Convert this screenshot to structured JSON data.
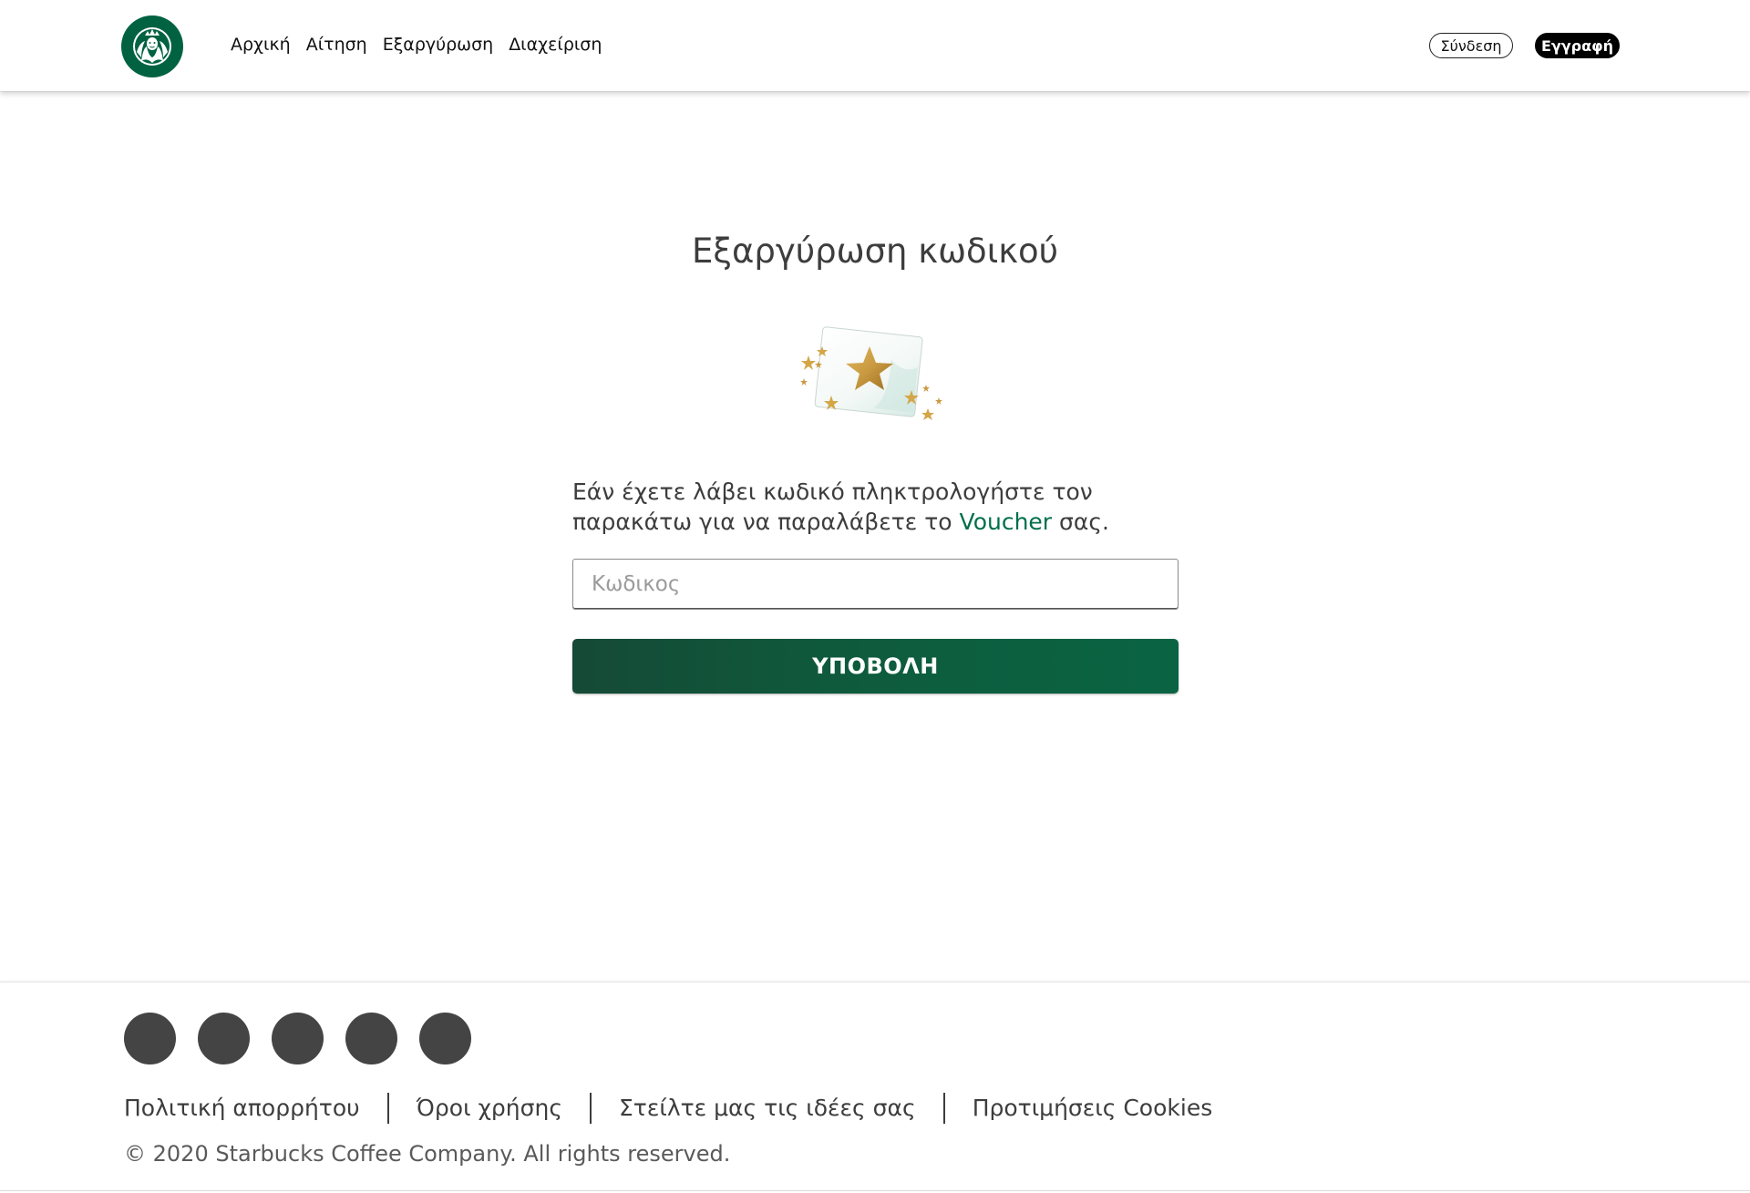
{
  "header": {
    "logo": "starbucks-siren-logo",
    "nav": [
      {
        "label": "Αρχική"
      },
      {
        "label": "Αίτηση"
      },
      {
        "label": "Εξαργύρωση"
      },
      {
        "label": "Διαχείριση"
      }
    ],
    "login_label": "Σύνδεση",
    "register_label": "Εγγραφή"
  },
  "main": {
    "title": "Εξαργύρωση κωδικού",
    "illustration": "voucher-card-stars",
    "instructions_before": "Εάν έχετε λάβει κωδικό πληκτρολογήστε τον παρακάτω για να παραλάβετε το ",
    "instructions_highlight": "Voucher",
    "instructions_after": " σας.",
    "code_input": {
      "value": "",
      "placeholder": "Κωδικος"
    },
    "submit_label": "ΥΠΟΒΟΛΗ"
  },
  "footer": {
    "social_icons": [
      "social-icon-1",
      "social-icon-2",
      "social-icon-3",
      "social-icon-4",
      "social-icon-5"
    ],
    "links": [
      {
        "label": "Πολιτική απορρήτου"
      },
      {
        "label": "Όροι χρήσης"
      },
      {
        "label": "Στείλτε μας τις ιδέες σας"
      },
      {
        "label": "Προτιμήσεις Cookies"
      }
    ],
    "copyright": "© 2020 Starbucks Coffee Company. All rights reserved."
  },
  "colors": {
    "brand_green": "#00704a",
    "button_green": "#0e5c3d",
    "text": "#3d3d3d",
    "social_circle": "#444444"
  }
}
